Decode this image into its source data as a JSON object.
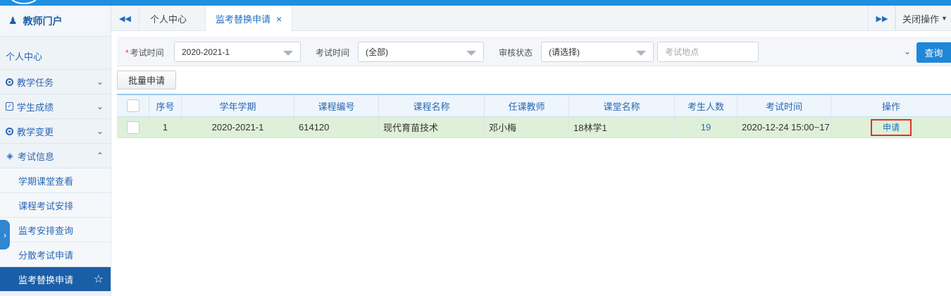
{
  "sidebar": {
    "portal_title": "教师门户",
    "personal_center": "个人中心",
    "menus": [
      {
        "label": "教学任务"
      },
      {
        "label": "学生成绩"
      },
      {
        "label": "教学变更"
      },
      {
        "label": "考试信息"
      }
    ],
    "sub_items": [
      {
        "label": "学期课堂查看"
      },
      {
        "label": "课程考试安排"
      },
      {
        "label": "监考安排查询"
      },
      {
        "label": "分散考试申请"
      },
      {
        "label": "监考替换申请"
      }
    ]
  },
  "tabs": {
    "items": [
      {
        "label": "个人中心"
      },
      {
        "label": "监考替换申请"
      }
    ],
    "close_ops": "关闭操作"
  },
  "filters": {
    "exam_time_label": "考试时间",
    "exam_time_value": "2020-2021-1",
    "exam_time2_label": "考试时间",
    "exam_time2_value": "(全部)",
    "review_label": "审核状态",
    "review_value": "(请选择)",
    "location_placeholder": "考试地点",
    "query_button": "查询"
  },
  "batch_button": "批量申请",
  "table": {
    "headers": [
      "序号",
      "学年学期",
      "课程编号",
      "课程名称",
      "任课教师",
      "课堂名称",
      "考生人数",
      "考试时间",
      "操作"
    ],
    "rows": [
      {
        "no": "1",
        "term": "2020-2021-1",
        "code": "614120",
        "course": "现代育苗技术",
        "teacher": "邓小梅",
        "class": "18林学1",
        "count": "19",
        "time": "2020-12-24 15:00~17",
        "action": "申请"
      }
    ]
  },
  "colors": {
    "accent": "#1f86d8",
    "sidebar_active": "#1a5ea8",
    "row_highlight": "#dff0d8",
    "highlight_box": "#e0322e"
  }
}
